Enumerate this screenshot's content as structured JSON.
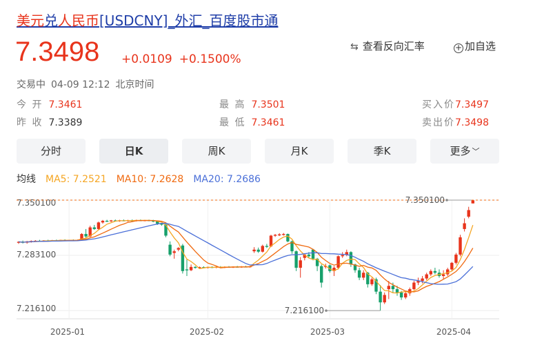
{
  "header": {
    "title_part1": "美元",
    "title_part2": "兑",
    "title_part3": "人民币",
    "title_part4": "[USDCNY]_外汇_百度股市通"
  },
  "quote": {
    "price": "7.3498",
    "change": "+0.0109",
    "change_pct": "+0.1500%",
    "reverse_rate_label": "查看反向汇率",
    "add_favorite_label": "加自选",
    "status": "交易中",
    "datetime": "04-09 12:12",
    "timezone": "北京时间",
    "open_label": "今 开",
    "open": "7.3461",
    "prev_close_label": "昨 收",
    "prev_close": "7.3389",
    "high_label": "最 高",
    "high": "7.3501",
    "low_label": "最 低",
    "low": "7.3461",
    "bid_label": "买入价",
    "bid": "7.3497",
    "ask_label": "卖出价",
    "ask": "7.3498"
  },
  "tabs": [
    {
      "label": "分时"
    },
    {
      "label": "日K"
    },
    {
      "label": "周K"
    },
    {
      "label": "月K"
    },
    {
      "label": "季K"
    },
    {
      "label": "更多"
    }
  ],
  "active_tab": "日K",
  "ma": {
    "label": "均线",
    "ma5": "MA5: 7.2521",
    "ma10": "MA10: 7.2628",
    "ma20": "MA20: 7.2686"
  },
  "colors": {
    "up": "#e8341c",
    "down": "#17a06b",
    "ma5": "#f5a623",
    "ma10": "#f06a10",
    "ma20": "#4a6fd8",
    "title": "#1f3ea8"
  },
  "chart_data": {
    "type": "candlestick",
    "y_ticks": [
      "7.350100",
      "7.283100",
      "7.216100"
    ],
    "y_tick_values": [
      7.3501,
      7.2831,
      7.2161
    ],
    "x_ticks": [
      "2025-01",
      "2025-02",
      "2025-03",
      "2025-04"
    ],
    "high_annotation": "7.350100",
    "low_annotation": "7.216100",
    "ylim": [
      7.2161,
      7.3501
    ],
    "candles": [
      [
        7.2988,
        7.3002,
        7.297,
        7.2995
      ],
      [
        7.2995,
        7.301,
        7.2975,
        7.2985
      ],
      [
        7.2985,
        7.3005,
        7.2972,
        7.3
      ],
      [
        7.3,
        7.3012,
        7.2985,
        7.3005
      ],
      [
        7.3005,
        7.3015,
        7.2995,
        7.3008
      ],
      [
        7.3008,
        7.3018,
        7.2998,
        7.3003
      ],
      [
        7.3003,
        7.3015,
        7.2995,
        7.3012
      ],
      [
        7.3012,
        7.302,
        7.3002,
        7.3008
      ],
      [
        7.3008,
        7.3018,
        7.3,
        7.3015
      ],
      [
        7.3015,
        7.3022,
        7.3005,
        7.301
      ],
      [
        7.301,
        7.302,
        7.3002,
        7.3018
      ],
      [
        7.3018,
        7.3025,
        7.301,
        7.3012
      ],
      [
        7.3012,
        7.302,
        7.3005,
        7.3016
      ],
      [
        7.3016,
        7.3024,
        7.3008,
        7.3014
      ],
      [
        7.3014,
        7.3022,
        7.3006,
        7.3018
      ],
      [
        7.3018,
        7.31,
        7.301,
        7.309
      ],
      [
        7.309,
        7.315,
        7.304,
        7.306
      ],
      [
        7.306,
        7.319,
        7.305,
        7.317
      ],
      [
        7.317,
        7.32,
        7.314,
        7.315
      ],
      [
        7.315,
        7.324,
        7.314,
        7.323
      ],
      [
        7.323,
        7.326,
        7.3215,
        7.325
      ],
      [
        7.325,
        7.3262,
        7.3238,
        7.3245
      ],
      [
        7.3245,
        7.326,
        7.3235,
        7.3255
      ],
      [
        7.3255,
        7.3265,
        7.324,
        7.3248
      ],
      [
        7.3248,
        7.3262,
        7.3238,
        7.3256
      ],
      [
        7.3256,
        7.3265,
        7.3245,
        7.325
      ],
      [
        7.325,
        7.3262,
        7.324,
        7.3258
      ],
      [
        7.3258,
        7.3266,
        7.3246,
        7.3252
      ],
      [
        7.3252,
        7.3264,
        7.3242,
        7.3258
      ],
      [
        7.3258,
        7.3266,
        7.3248,
        7.3254
      ],
      [
        7.3254,
        7.3262,
        7.3244,
        7.3258
      ],
      [
        7.3258,
        7.3264,
        7.3248,
        7.3252
      ],
      [
        7.3252,
        7.3262,
        7.3232,
        7.3245
      ],
      [
        7.3245,
        7.3252,
        7.32,
        7.3215
      ],
      [
        7.3215,
        7.3222,
        7.319,
        7.3205
      ],
      [
        7.3205,
        7.3212,
        7.305,
        7.307
      ],
      [
        7.296,
        7.3,
        7.282,
        7.284
      ],
      [
        7.286,
        7.29,
        7.279,
        7.288
      ],
      [
        7.29,
        7.293,
        7.288,
        7.292
      ],
      [
        7.295,
        7.297,
        7.261,
        7.264
      ],
      [
        7.266,
        7.278,
        7.258,
        7.265
      ],
      [
        7.265,
        7.272,
        7.264,
        7.269
      ],
      [
        7.269,
        7.27,
        7.267,
        7.268
      ],
      [
        7.268,
        7.2695,
        7.2668,
        7.2688
      ],
      [
        7.2688,
        7.2698,
        7.2674,
        7.2682
      ],
      [
        7.2682,
        7.2694,
        7.2672,
        7.269
      ],
      [
        7.269,
        7.2698,
        7.2676,
        7.2684
      ],
      [
        7.2684,
        7.2696,
        7.2674,
        7.2692
      ],
      [
        7.2692,
        7.27,
        7.2678,
        7.2686
      ],
      [
        7.2686,
        7.2698,
        7.2676,
        7.2692
      ],
      [
        7.2692,
        7.27,
        7.268,
        7.2688
      ],
      [
        7.2688,
        7.2698,
        7.2678,
        7.2694
      ],
      [
        7.2694,
        7.2702,
        7.2682,
        7.269
      ],
      [
        7.269,
        7.27,
        7.268,
        7.2695
      ],
      [
        7.2695,
        7.2704,
        7.2685,
        7.2692
      ],
      [
        7.2692,
        7.2702,
        7.2682,
        7.2698
      ],
      [
        7.288,
        7.293,
        7.286,
        7.29
      ],
      [
        7.29,
        7.2925,
        7.286,
        7.2875
      ],
      [
        7.2875,
        7.296,
        7.2865,
        7.2945
      ],
      [
        7.2945,
        7.297,
        7.292,
        7.294
      ],
      [
        7.294,
        7.308,
        7.293,
        7.307
      ],
      [
        7.307,
        7.309,
        7.3055,
        7.308
      ],
      [
        7.308,
        7.31,
        7.3065,
        7.3085
      ],
      [
        7.3085,
        7.3102,
        7.307,
        7.309
      ],
      [
        7.309,
        7.3095,
        7.299,
        7.3
      ],
      [
        7.3,
        7.301,
        7.285,
        7.288
      ],
      [
        7.288,
        7.289,
        7.264,
        7.268
      ],
      [
        7.268,
        7.281,
        7.256,
        7.277
      ],
      [
        7.28,
        7.285,
        7.277,
        7.284
      ],
      [
        7.284,
        7.287,
        7.28,
        7.282
      ],
      [
        7.29,
        7.291,
        7.277,
        7.279
      ],
      [
        7.279,
        7.28,
        7.264,
        7.27
      ],
      [
        7.27,
        7.272,
        7.244,
        7.25
      ],
      [
        7.269,
        7.273,
        7.267,
        7.27
      ],
      [
        7.271,
        7.272,
        7.262,
        7.264
      ],
      [
        7.264,
        7.27,
        7.258,
        7.268
      ],
      [
        7.268,
        7.283,
        7.266,
        7.282
      ],
      [
        7.282,
        7.287,
        7.28,
        7.2835
      ],
      [
        7.2835,
        7.29,
        7.282,
        7.287
      ],
      [
        7.287,
        7.288,
        7.269,
        7.272
      ],
      [
        7.272,
        7.273,
        7.262,
        7.265
      ],
      [
        7.265,
        7.268,
        7.253,
        7.256
      ],
      [
        7.256,
        7.265,
        7.253,
        7.262
      ],
      [
        7.262,
        7.263,
        7.244,
        7.248
      ],
      [
        7.248,
        7.256,
        7.246,
        7.254
      ],
      [
        7.254,
        7.256,
        7.236,
        7.239
      ],
      [
        7.239,
        7.247,
        7.216,
        7.226
      ],
      [
        7.226,
        7.238,
        7.224,
        7.235
      ],
      [
        7.242,
        7.252,
        7.23,
        7.246
      ],
      [
        7.246,
        7.25,
        7.238,
        7.242
      ],
      [
        7.242,
        7.246,
        7.234,
        7.238
      ],
      [
        7.238,
        7.24,
        7.229,
        7.232
      ],
      [
        7.232,
        7.24,
        7.23,
        7.237
      ],
      [
        7.237,
        7.244,
        7.234,
        7.242
      ],
      [
        7.242,
        7.252,
        7.241,
        7.25
      ],
      [
        7.25,
        7.256,
        7.247,
        7.252
      ],
      [
        7.252,
        7.258,
        7.249,
        7.255
      ],
      [
        7.255,
        7.262,
        7.253,
        7.26
      ],
      [
        7.26,
        7.266,
        7.258,
        7.264
      ],
      [
        7.264,
        7.268,
        7.26,
        7.262
      ],
      [
        7.262,
        7.266,
        7.256,
        7.258
      ],
      [
        7.258,
        7.265,
        7.254,
        7.26
      ],
      [
        7.26,
        7.268,
        7.258,
        7.266
      ],
      [
        7.266,
        7.275,
        7.264,
        7.274
      ],
      [
        7.274,
        7.286,
        7.272,
        7.284
      ],
      [
        7.284,
        7.308,
        7.282,
        7.305
      ],
      [
        7.315,
        7.328,
        7.312,
        7.322
      ],
      [
        7.33,
        7.342,
        7.328,
        7.338
      ],
      [
        7.3461,
        7.3501,
        7.3461,
        7.3498
      ]
    ]
  }
}
